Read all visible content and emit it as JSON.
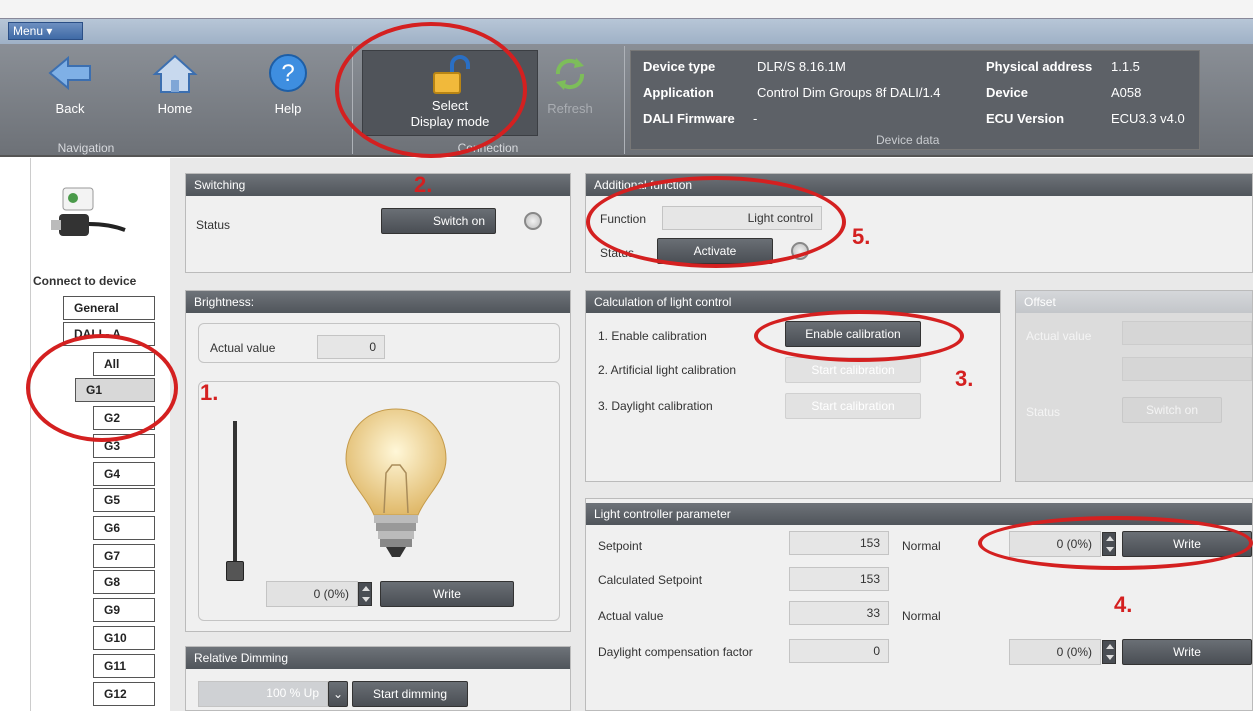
{
  "menu": {
    "label": "Menu ▾"
  },
  "ribbon": {
    "back": "Back",
    "home": "Home",
    "help": "Help",
    "select_line1": "Select",
    "select_line2": "Display mode",
    "refresh": "Refresh",
    "group_navigation": "Navigation",
    "group_connection": "Connection",
    "group_device_data": "Device data"
  },
  "device_data": {
    "device_type_label": "Device type",
    "device_type_value": "DLR/S 8.16.1M",
    "application_label": "Application",
    "application_value": "Control Dim Groups 8f DALI/1.4",
    "dali_firmware_label": "DALI Firmware",
    "dali_firmware_value": "-",
    "physical_address_label": "Physical address",
    "physical_address_value": "1.1.5",
    "device_label": "Device",
    "device_value": "A058",
    "ecu_version_label": "ECU Version",
    "ecu_version_value": "ECU3.3 v4.0"
  },
  "left": {
    "connect_label": "Connect to device",
    "general": "General",
    "dali": "DALI - A",
    "items": [
      "All",
      "G1",
      "G2",
      "G3",
      "G4",
      "G5",
      "G6",
      "G7",
      "G8",
      "G9",
      "G10",
      "G11",
      "G12"
    ]
  },
  "switching": {
    "title": "Switching",
    "status_label": "Status",
    "button": "Switch on"
  },
  "brightness": {
    "title": "Brightness:",
    "actual_label": "Actual value",
    "actual_value": "0",
    "spin_value": "0 (0%)",
    "write": "Write"
  },
  "relative_dimming": {
    "title": "Relative Dimming",
    "value": "100 % Up",
    "button": "Start dimming"
  },
  "additional": {
    "title": "Additional function",
    "function_label": "Function",
    "function_value": "Light control",
    "status_label": "Status",
    "activate": "Activate"
  },
  "calibration": {
    "title": "Calculation of light control",
    "step1": "1. Enable calibration",
    "step1_btn": "Enable calibration",
    "step2": "2. Artificial light calibration",
    "step2_btn": "Start calibration",
    "step3": "3. Daylight calibration",
    "step3_btn": "Start calibration"
  },
  "offset": {
    "title": "Offset",
    "actual_label": "Actual value",
    "status_label": "Status",
    "button": "Switch on"
  },
  "controller": {
    "title": "Light controller parameter",
    "setpoint_label": "Setpoint",
    "setpoint_value": "153",
    "setpoint_status": "Normal",
    "setpoint_spin": "0 (0%)",
    "write": "Write",
    "calc_label": "Calculated Setpoint",
    "calc_value": "153",
    "actual_label": "Actual value",
    "actual_value": "33",
    "actual_status": "Normal",
    "daylight_label": "Daylight compensation factor",
    "daylight_value": "0",
    "daylight_spin": "0 (0%)",
    "write2": "Write"
  },
  "annotations": [
    "1.",
    "2.",
    "3.",
    "4.",
    "5."
  ],
  "colors": {
    "annotation": "#d42020",
    "ribbon": "#6d7177",
    "panel_header": "#50555b"
  }
}
